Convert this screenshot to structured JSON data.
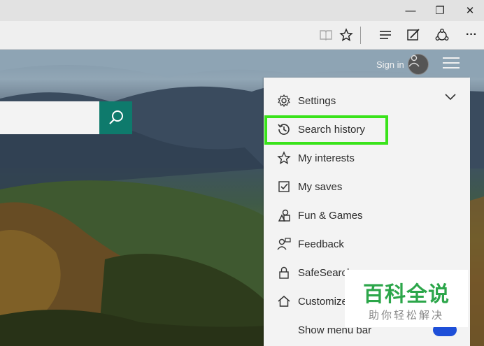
{
  "window": {
    "minimize_glyph": "—",
    "restore_glyph": "❐",
    "close_glyph": "✕"
  },
  "toolbar": {
    "icons": [
      "reading-view-icon",
      "favorites-star-icon",
      "hub-icon",
      "web-note-icon",
      "share-icon",
      "more-icon"
    ],
    "more_glyph": "···"
  },
  "header": {
    "sign_in_label": "Sign in"
  },
  "search": {
    "placeholder": ""
  },
  "menu": {
    "items": [
      {
        "label": "Settings",
        "icon": "gear-icon"
      },
      {
        "label": "Search history",
        "icon": "history-clock-icon"
      },
      {
        "label": "My interests",
        "icon": "star-outline-icon"
      },
      {
        "label": "My saves",
        "icon": "checkbox-icon"
      },
      {
        "label": "Fun & Games",
        "icon": "games-icon"
      },
      {
        "label": "Feedback",
        "icon": "feedback-person-icon"
      },
      {
        "label": "SafeSearch",
        "icon": "lock-icon"
      },
      {
        "label": "Customize",
        "icon": "home-icon"
      },
      {
        "label": "Show menu bar",
        "icon": ""
      }
    ]
  },
  "colors": {
    "search_button": "#0e7a6c",
    "highlight_border": "#39e31a",
    "toggle_on": "#1e4fd8"
  },
  "watermark": {
    "main": "百科全说",
    "sub": "助你轻松解决"
  }
}
